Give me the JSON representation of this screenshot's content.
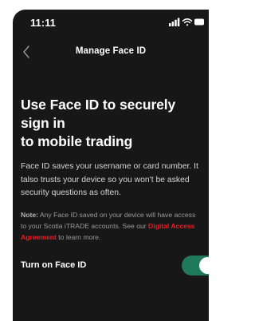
{
  "status_bar": {
    "time": "11:11",
    "signal_icon": "cellular-signal-icon",
    "wifi_icon": "wifi-icon",
    "battery_icon": "battery-icon"
  },
  "nav": {
    "back_icon": "chevron-left-icon",
    "title": "Manage Face ID"
  },
  "main": {
    "heading_line1": "Use Face ID to securely sign in",
    "heading_line2": "to mobile trading",
    "description_line1": "Face ID saves your username or card number. It",
    "description_line2": "talso trusts your device so you won't be asked",
    "description_line3": "security questions as often.",
    "note_label": "Note:",
    "note_line1": " Any Face ID saved on your device will have access",
    "note_line2_pre": "to your Scotia iTRADE accounts. See our ",
    "note_link_part1": "Digital Access",
    "note_link_part2": "Agreement",
    "note_line3_post": " to learn more."
  },
  "toggle": {
    "label": "Turn on Face ID",
    "on": true
  },
  "colors": {
    "background": "#171717",
    "link": "#ec1c24",
    "toggle_on": "#1f7a5c",
    "text_primary": "#ffffff",
    "text_secondary": "#d6d6d6",
    "text_muted": "#9a9a9a"
  }
}
